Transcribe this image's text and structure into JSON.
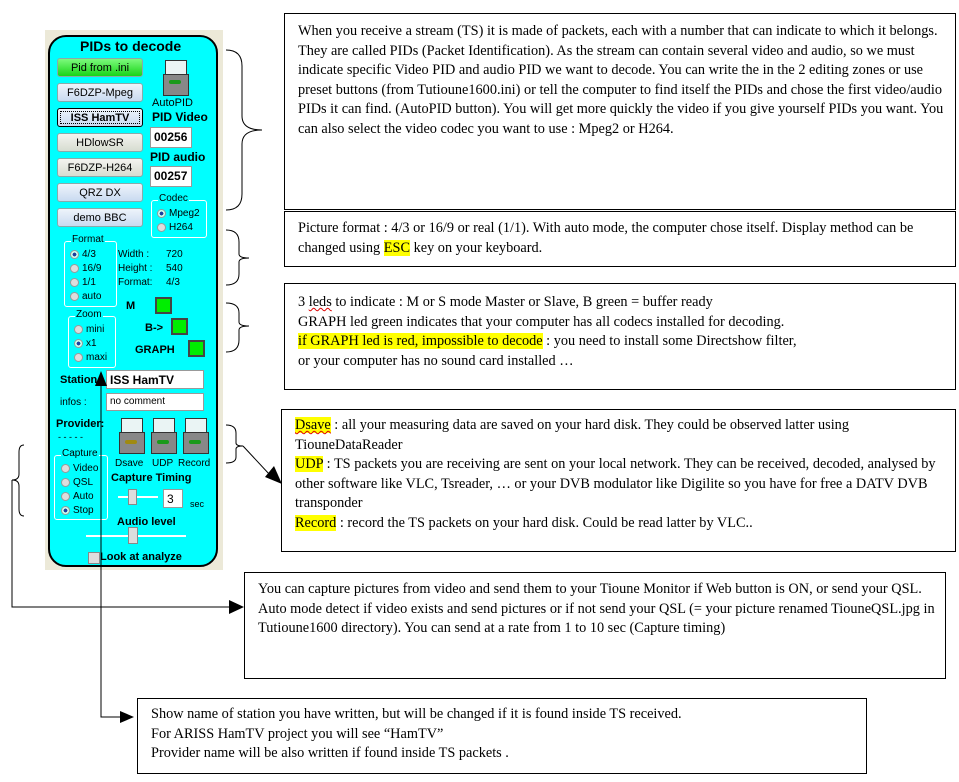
{
  "panel": {
    "title": "PIDs to decode",
    "preset_buttons": [
      {
        "label": "Pid from .ini",
        "style": "green"
      },
      {
        "label": "F6DZP-Mpeg",
        "style": "blue"
      },
      {
        "label": "ISS HamTV",
        "style": "selected"
      },
      {
        "label": "HDlowSR",
        "style": "grey"
      },
      {
        "label": "F6DZP-H264",
        "style": "grey"
      },
      {
        "label": "QRZ DX",
        "style": "blue"
      },
      {
        "label": "demo BBC",
        "style": "blue"
      }
    ],
    "autopid_label": "AutoPID",
    "pid_video_label": "PID Video",
    "pid_video_value": "00256",
    "pid_audio_label": "PID audio",
    "pid_audio_value": "00257",
    "codec": {
      "title": "Codec",
      "options": [
        "Mpeg2",
        "H264"
      ],
      "selected": "Mpeg2"
    },
    "format": {
      "title": "Format",
      "options": [
        "4/3",
        "16/9",
        "1/1",
        "auto"
      ],
      "selected": "4/3"
    },
    "info": {
      "width_label": "Width :",
      "width_value": "720",
      "height_label": "Height :",
      "height_value": "540",
      "format_label": "Format:",
      "format_value": "4/3"
    },
    "zoom": {
      "title": "Zoom",
      "options": [
        "mini",
        "x1",
        "maxi"
      ],
      "selected": "x1"
    },
    "leds": [
      {
        "label": "M",
        "color": "#00ee00"
      },
      {
        "label": "B->",
        "color": "#00ee00"
      },
      {
        "label": "GRAPH",
        "color": "#00ee00"
      }
    ],
    "station_label": "Station",
    "station_value": "ISS HamTV",
    "infos_label": "infos :",
    "infos_value": "no comment",
    "provider_label": "Provider:",
    "provider_value": "- - - - -",
    "capture": {
      "title": "Capture",
      "options": [
        "Video",
        "QSL",
        "Auto",
        "Stop"
      ],
      "selected": "Stop"
    },
    "switches": [
      {
        "label": "Dsave",
        "led_color": "#a08a10"
      },
      {
        "label": "UDP",
        "led_color": "#1a9a1a"
      },
      {
        "label": "Record",
        "led_color": "#1a9a1a"
      }
    ],
    "capture_timing_label": "Capture Timing",
    "capture_timing_value": "3",
    "capture_timing_unit": "sec",
    "audio_level_label": "Audio level",
    "look_at_analyze_label": "Look at analyze"
  },
  "notes": {
    "pids": "When you receive a stream (TS) it is made of packets, each with a number that can indicate to which it belongs. They are called PIDs (Packet Identification). As the stream can contain several video and audio, so we must indicate specific Video PID and audio PID we want to decode. You can write the in the 2 editing zones or use preset buttons (from Tutioune1600.ini) or tell the computer to find itself the PIDs and chose the first video/audio PIDs it can find. (AutoPID button). You will get more quickly the video if you give yourself PIDs you want. You can also select the video codec you want to use : Mpeg2 or H264.",
    "format_a": "Picture format : 4/3 or 16/9 or real (1/1). With auto mode, the computer chose itself. Display method can be changed using ",
    "format_hl": "ESC",
    "format_b": " key on your keyboard.",
    "leds_1a": "3 ",
    "leds_1sq": "leds",
    "leds_1b": " to indicate : M or S mode Master or Slave, B green = buffer ready",
    "leds_2": "GRAPH led green indicates that your computer has all codecs installed for decoding.",
    "leds_3hl": "if GRAPH led is red, impossible to decode",
    "leds_3b": " : you need to install some Directshow filter,",
    "leds_4": "or your computer has no sound card installed …",
    "dsave_hl": "Dsave",
    "dsave_text": " : all your measuring data are saved on your hard disk. They could be observed latter using TiouneDataReader",
    "udp_hl": "UDP",
    "udp_text": " : TS packets you are receiving are sent on your local network. They can be received, decoded, analysed by other software like VLC, Tsreader, … or your DVB modulator like Digilite so you have for free a DATV DVB transponder",
    "record_hl": "Record",
    "record_text": " : record the TS packets on your hard disk. Could be read latter by VLC..",
    "capture": "You can capture pictures from video and send them to your Tioune Monitor if Web button is ON, or send your QSL. Auto mode detect if video exists and send pictures or if not send your QSL (= your picture renamed TiouneQSL.jpg in Tutioune1600 directory). You can send at a rate from 1 to 10 sec (Capture timing)",
    "station_1": "Show name of station you have written, but will be changed if it is found inside TS received.",
    "station_2": "For ARISS HamTV project you will see “HamTV”",
    "station_3": "Provider name will be also written if found inside TS packets ."
  }
}
